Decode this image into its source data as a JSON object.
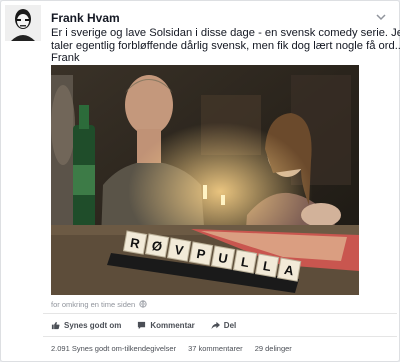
{
  "post": {
    "author": "Frank Hvam",
    "text_lines": [
      "Er i sverige og lave Solsidan i disse dage - en svensk comedy serie. Jeg",
      "taler egentlig forbløffende dårlig svensk, men fik dog lært nogle få ord...",
      "Frank"
    ],
    "photo_tiles": [
      "R",
      "Ø",
      "V",
      "P",
      "U",
      "L",
      "L",
      "A"
    ],
    "timestamp": "for omkring en time siden"
  },
  "actions": {
    "like": "Synes godt om",
    "comment": "Kommentar",
    "share": "Del"
  },
  "stats": {
    "likes": "2.091 Synes godt om-tilkendegivelser",
    "comments": "37 kommentarer",
    "shares": "29 delinger"
  },
  "colors": {
    "link": "#3b5998",
    "text": "#141823",
    "meta": "#90949c"
  }
}
